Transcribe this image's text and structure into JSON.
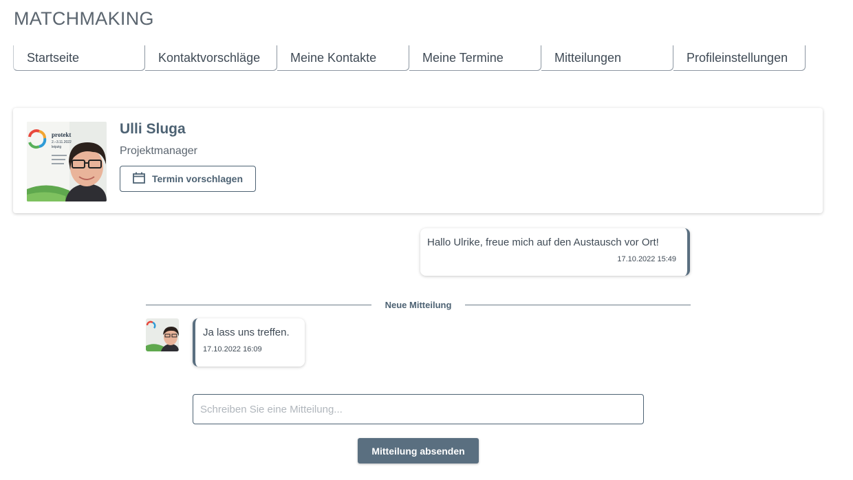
{
  "page": {
    "title": "MATCHMAKING"
  },
  "tabs": [
    {
      "label": "Startseite"
    },
    {
      "label": "Kontaktvorschläge"
    },
    {
      "label": "Meine Kontakte"
    },
    {
      "label": "Meine Termine"
    },
    {
      "label": "Mitteilungen"
    },
    {
      "label": "Profileinstellungen"
    }
  ],
  "profile": {
    "name": "Ulli Sluga",
    "role": "Projektmanager",
    "appointment_button": "Termin vorschlagen",
    "photo_text": [
      "protekt",
      "2.–3.11.2022",
      "leipzig"
    ]
  },
  "messages": {
    "outgoing": {
      "text": "Hallo Ulrike, freue mich auf den Austausch vor Ort!",
      "time": "17.10.2022 15:49"
    },
    "divider_label": "Neue Mitteilung",
    "incoming": {
      "text": "Ja lass uns treffen.",
      "time": "17.10.2022 16:09"
    }
  },
  "composer": {
    "value": "",
    "placeholder": "Schreiben Sie eine Mitteilung...",
    "send_label": "Mitteilung absenden"
  },
  "colors": {
    "accent": "#5a6f80",
    "text": "#3f4a55",
    "name": "#4d6273"
  }
}
